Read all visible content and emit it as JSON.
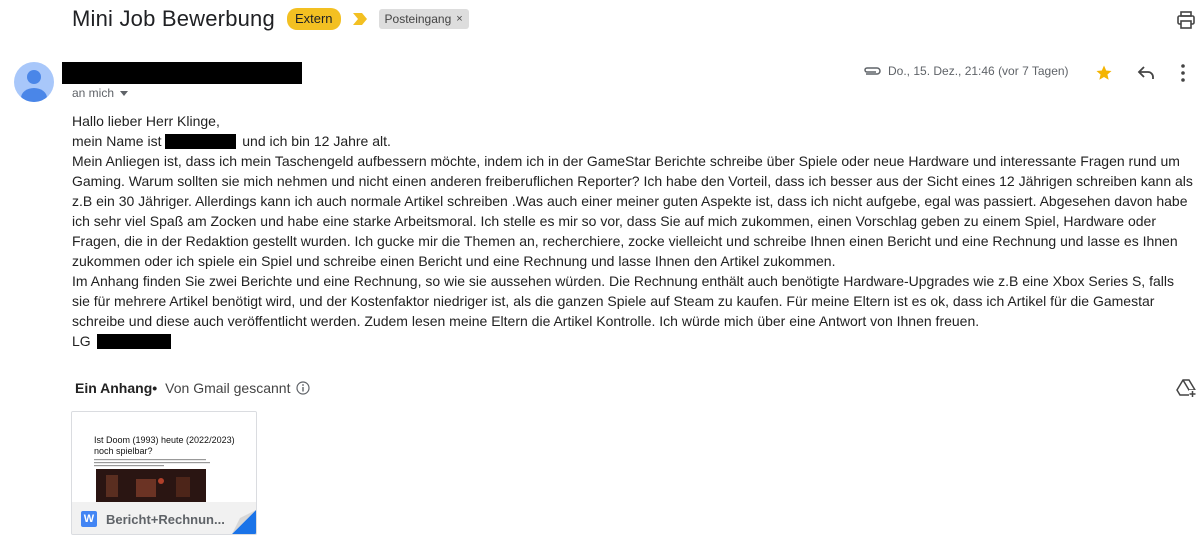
{
  "subject": "Mini Job Bewerbung",
  "badges": {
    "extern": "Extern",
    "label": "Posteingang",
    "label_remove": "×"
  },
  "sender": {
    "to": "an mich"
  },
  "meta": {
    "date": "Do., 15. Dez., 21:46 (vor 7 Tagen)"
  },
  "body": {
    "greeting": "Hallo lieber Herr Klinge,",
    "name_prefix": "mein Name ist",
    "name_suffix": "und ich bin 12 Jahre alt.",
    "paragraph1": "Mein Anliegen ist, dass ich mein Taschengeld aufbessern möchte, indem ich in der GameStar Berichte schreibe über Spiele oder neue Hardware und interessante Fragen rund um Gaming. Warum sollten sie mich nehmen und nicht einen anderen freiberuflichen Reporter? Ich habe den Vorteil, dass ich besser aus der Sicht eines 12 Jährigen schreiben kann als z.B ein 30 Jähriger. Allerdings kann ich auch normale Artikel schreiben .Was auch einer meiner guten Aspekte ist, dass ich nicht aufgebe, egal was passiert. Abgesehen davon habe ich sehr viel Spaß am Zocken und habe eine starke Arbeitsmoral. Ich stelle es mir so vor, dass Sie auf mich zukommen, einen Vorschlag geben zu einem Spiel, Hardware oder Fragen, die in der Redaktion gestellt wurden. Ich gucke mir die Themen an, recherchiere, zocke vielleicht und schreibe Ihnen einen Bericht und eine Rechnung und lasse es Ihnen zukommen oder ich spiele ein Spiel und schreibe einen Bericht und eine Rechnung und lasse Ihnen den Artikel zukommen.",
    "paragraph2": "Im Anhang finden Sie zwei Berichte und eine Rechnung, so wie sie aussehen würden. Die Rechnung enthält auch benötigte Hardware-Upgrades wie z.B eine Xbox Series S, falls sie für mehrere Artikel benötigt wird, und der Kostenfaktor niedriger ist, als die ganzen Spiele auf Steam zu kaufen. Für meine Eltern ist es ok, dass ich Artikel für die Gamestar schreibe und diese auch veröffentlicht werden. Zudem lesen meine Eltern die Artikel Kontrolle. Ich würde mich über eine Antwort von Ihnen freuen.",
    "signoff": "LG"
  },
  "attachments": {
    "heading": "Ein Anhang",
    "separator": "•",
    "scanned": "Von Gmail gescannt",
    "file": {
      "preview_title": "Ist Doom (1993) heute (2022/2023) noch spielbar?",
      "name": "Bericht+Rechnun...",
      "type_letter": "W"
    }
  },
  "colors": {
    "extern_badge": "#f3c022",
    "star": "#f4b400",
    "avatar": "#a8c7fa",
    "word_blue": "#4285f4"
  }
}
